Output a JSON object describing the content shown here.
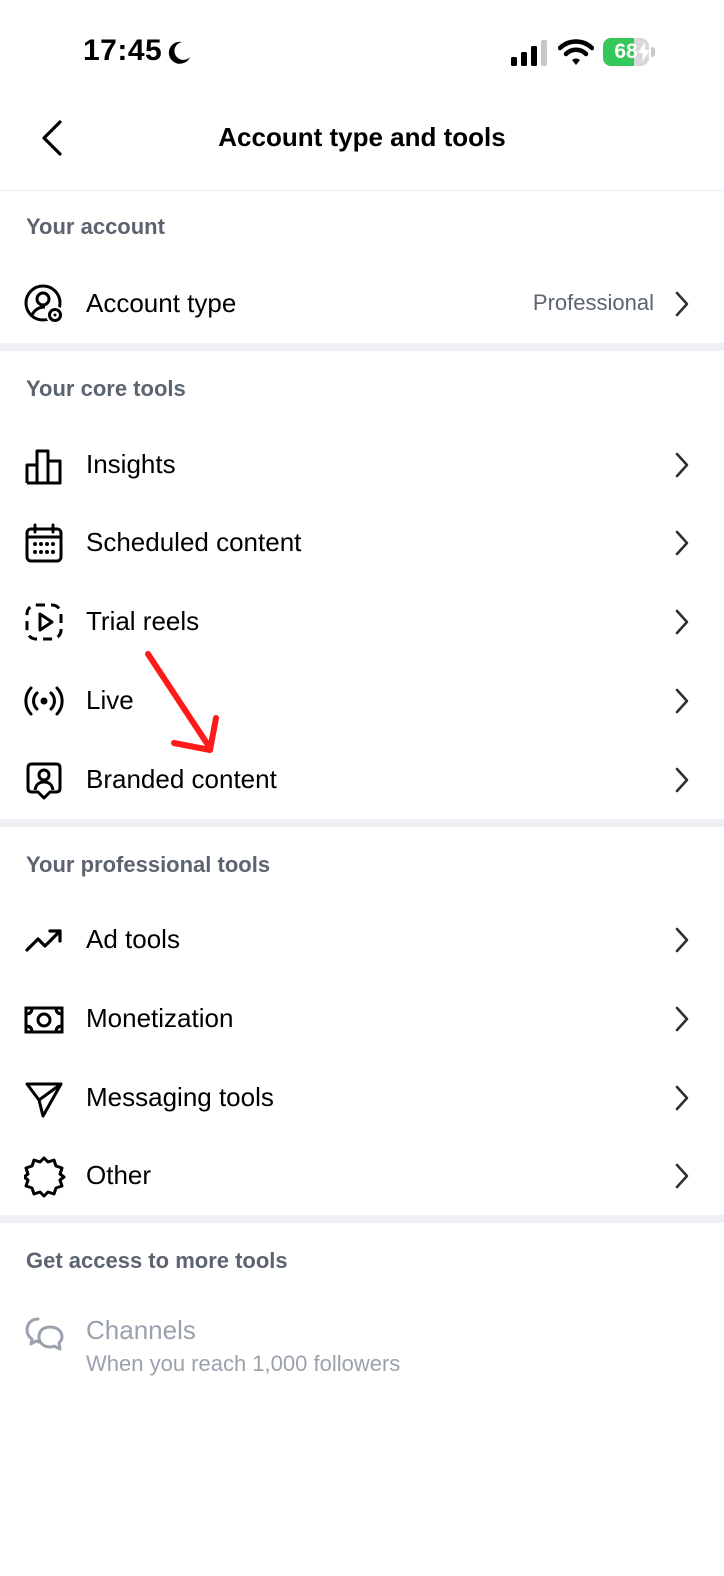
{
  "status": {
    "time": "17:45",
    "battery": "68",
    "battery_level": 0.68
  },
  "header": {
    "title": "Account type and tools"
  },
  "sections": {
    "account": {
      "title": "Your account",
      "account_type": {
        "label": "Account type",
        "value": "Professional"
      }
    },
    "core": {
      "title": "Your core tools",
      "items": [
        {
          "label": "Insights",
          "icon": "bar-chart-icon"
        },
        {
          "label": "Scheduled content",
          "icon": "calendar-icon"
        },
        {
          "label": "Trial reels",
          "icon": "trial-reels-icon"
        },
        {
          "label": "Live",
          "icon": "live-icon"
        },
        {
          "label": "Branded content",
          "icon": "branded-content-icon"
        }
      ]
    },
    "professional": {
      "title": "Your professional tools",
      "items": [
        {
          "label": "Ad tools",
          "icon": "trending-up-icon"
        },
        {
          "label": "Monetization",
          "icon": "money-icon"
        },
        {
          "label": "Messaging tools",
          "icon": "messaging-icon"
        },
        {
          "label": "Other",
          "icon": "gear-icon"
        }
      ]
    },
    "more": {
      "title": "Get access to more tools",
      "channels": {
        "label": "Channels",
        "sub": "When you reach 1,000 followers"
      }
    }
  },
  "colors": {
    "section_title": "#5c6470",
    "divider": "#eef0f3",
    "battery": "#34c759",
    "annotation_arrow": "#ff1a1a",
    "disabled": "#9aa2ad"
  }
}
